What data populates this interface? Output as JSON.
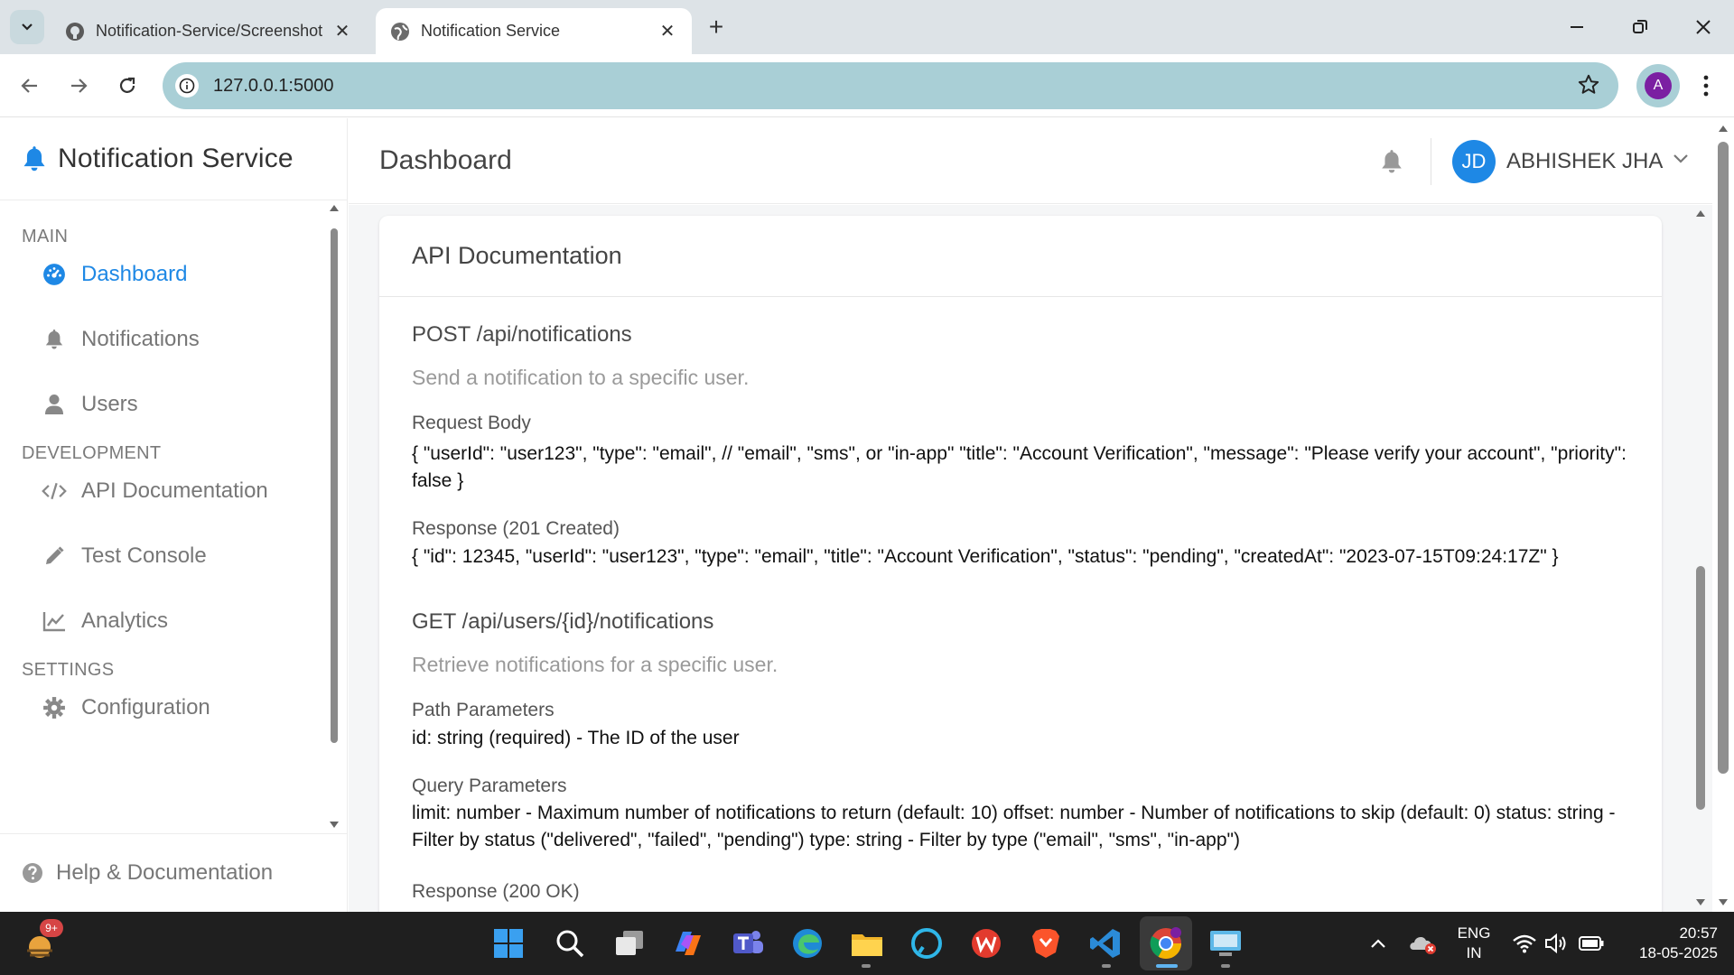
{
  "browser": {
    "tabs": [
      {
        "title": "Notification-Service/Screenshot",
        "active": false,
        "favicon": "github-icon"
      },
      {
        "title": "Notification Service",
        "active": true,
        "favicon": "globe-icon"
      }
    ],
    "url": "127.0.0.1:5000",
    "profile_initial": "A"
  },
  "app": {
    "brand": "Notification Service",
    "page_title": "Dashboard",
    "user": {
      "initials": "JD",
      "name": "ABHISHEK JHA"
    }
  },
  "sidebar": {
    "sections": [
      {
        "label": "MAIN",
        "items": [
          {
            "label": "Dashboard",
            "icon": "dashboard-icon",
            "active": true
          },
          {
            "label": "Notifications",
            "icon": "bell-icon"
          },
          {
            "label": "Users",
            "icon": "user-icon"
          }
        ]
      },
      {
        "label": "DEVELOPMENT",
        "items": [
          {
            "label": "API Documentation",
            "icon": "code-icon"
          },
          {
            "label": "Test Console",
            "icon": "pencil-icon"
          },
          {
            "label": "Analytics",
            "icon": "chart-line-icon"
          }
        ]
      },
      {
        "label": "SETTINGS",
        "items": [
          {
            "label": "Configuration",
            "icon": "gear-icon"
          }
        ]
      }
    ],
    "help": "Help & Documentation"
  },
  "doc": {
    "title": "API Documentation",
    "endpoints": [
      {
        "title": "POST /api/notifications",
        "desc": "Send a notification to a specific user.",
        "blocks": [
          {
            "label": "Request Body",
            "text": "{ \"userId\": \"user123\", \"type\": \"email\", // \"email\", \"sms\", or \"in-app\" \"title\": \"Account Verification\", \"message\": \"Please verify your account\", \"priority\": false }"
          },
          {
            "label": "Response (201 Created)",
            "text": "{ \"id\": 12345, \"userId\": \"user123\", \"type\": \"email\", \"title\": \"Account Verification\", \"status\": \"pending\", \"createdAt\": \"2023-07-15T09:24:17Z\" }"
          }
        ]
      },
      {
        "title": "GET /api/users/{id}/notifications",
        "desc": "Retrieve notifications for a specific user.",
        "blocks": [
          {
            "label": "Path Parameters",
            "text": "id: string (required) - The ID of the user"
          },
          {
            "label": "Query Parameters",
            "text": "limit: number - Maximum number of notifications to return (default: 10) offset: number - Number of notifications to skip (default: 0) status: string - Filter by status (\"delivered\", \"failed\", \"pending\") type: string - Filter by type (\"email\", \"sms\", \"in-app\")"
          },
          {
            "label": "Response (200 OK)",
            "text": ""
          }
        ]
      }
    ]
  },
  "taskbar": {
    "badge": "9+",
    "lang": "ENG",
    "region": "IN",
    "time": "20:57",
    "date": "18-05-2025"
  },
  "colors": {
    "accent": "#1e88e5",
    "omnibox": "#a9cfd6",
    "tabstrip": "#dde3e7",
    "taskbar": "#1f1f1f"
  }
}
